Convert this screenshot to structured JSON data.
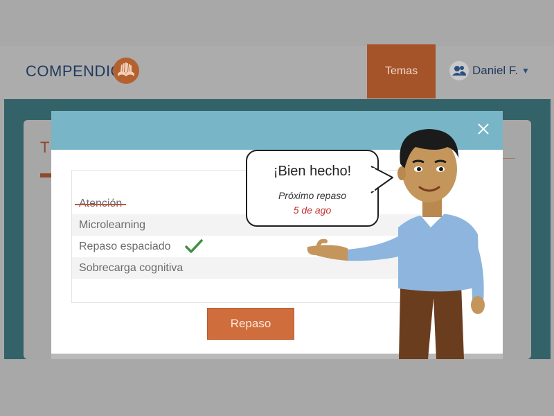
{
  "brand": {
    "name": "COMPENDIO",
    "logo_icon": "book-hands-icon",
    "accent_color": "#d06d3c"
  },
  "nav": {
    "temas_label": "Temas"
  },
  "user": {
    "name": "Daniel F.",
    "icon": "users-icon",
    "caret": "▼"
  },
  "background_card": {
    "title_fragment": "T"
  },
  "modal": {
    "close_icon": "close-icon",
    "items": [
      {
        "label": "Atención",
        "state": "struck-through"
      },
      {
        "label": "Microlearning",
        "state": "none"
      },
      {
        "label": "Repaso espaciado",
        "state": "checked"
      },
      {
        "label": "Sobrecarga cognitiva",
        "state": "none"
      }
    ],
    "button_label": "Repaso"
  },
  "bubble": {
    "title": "¡Bien hecho!",
    "subtitle": "Próximo repaso",
    "date": "5 de ago"
  }
}
